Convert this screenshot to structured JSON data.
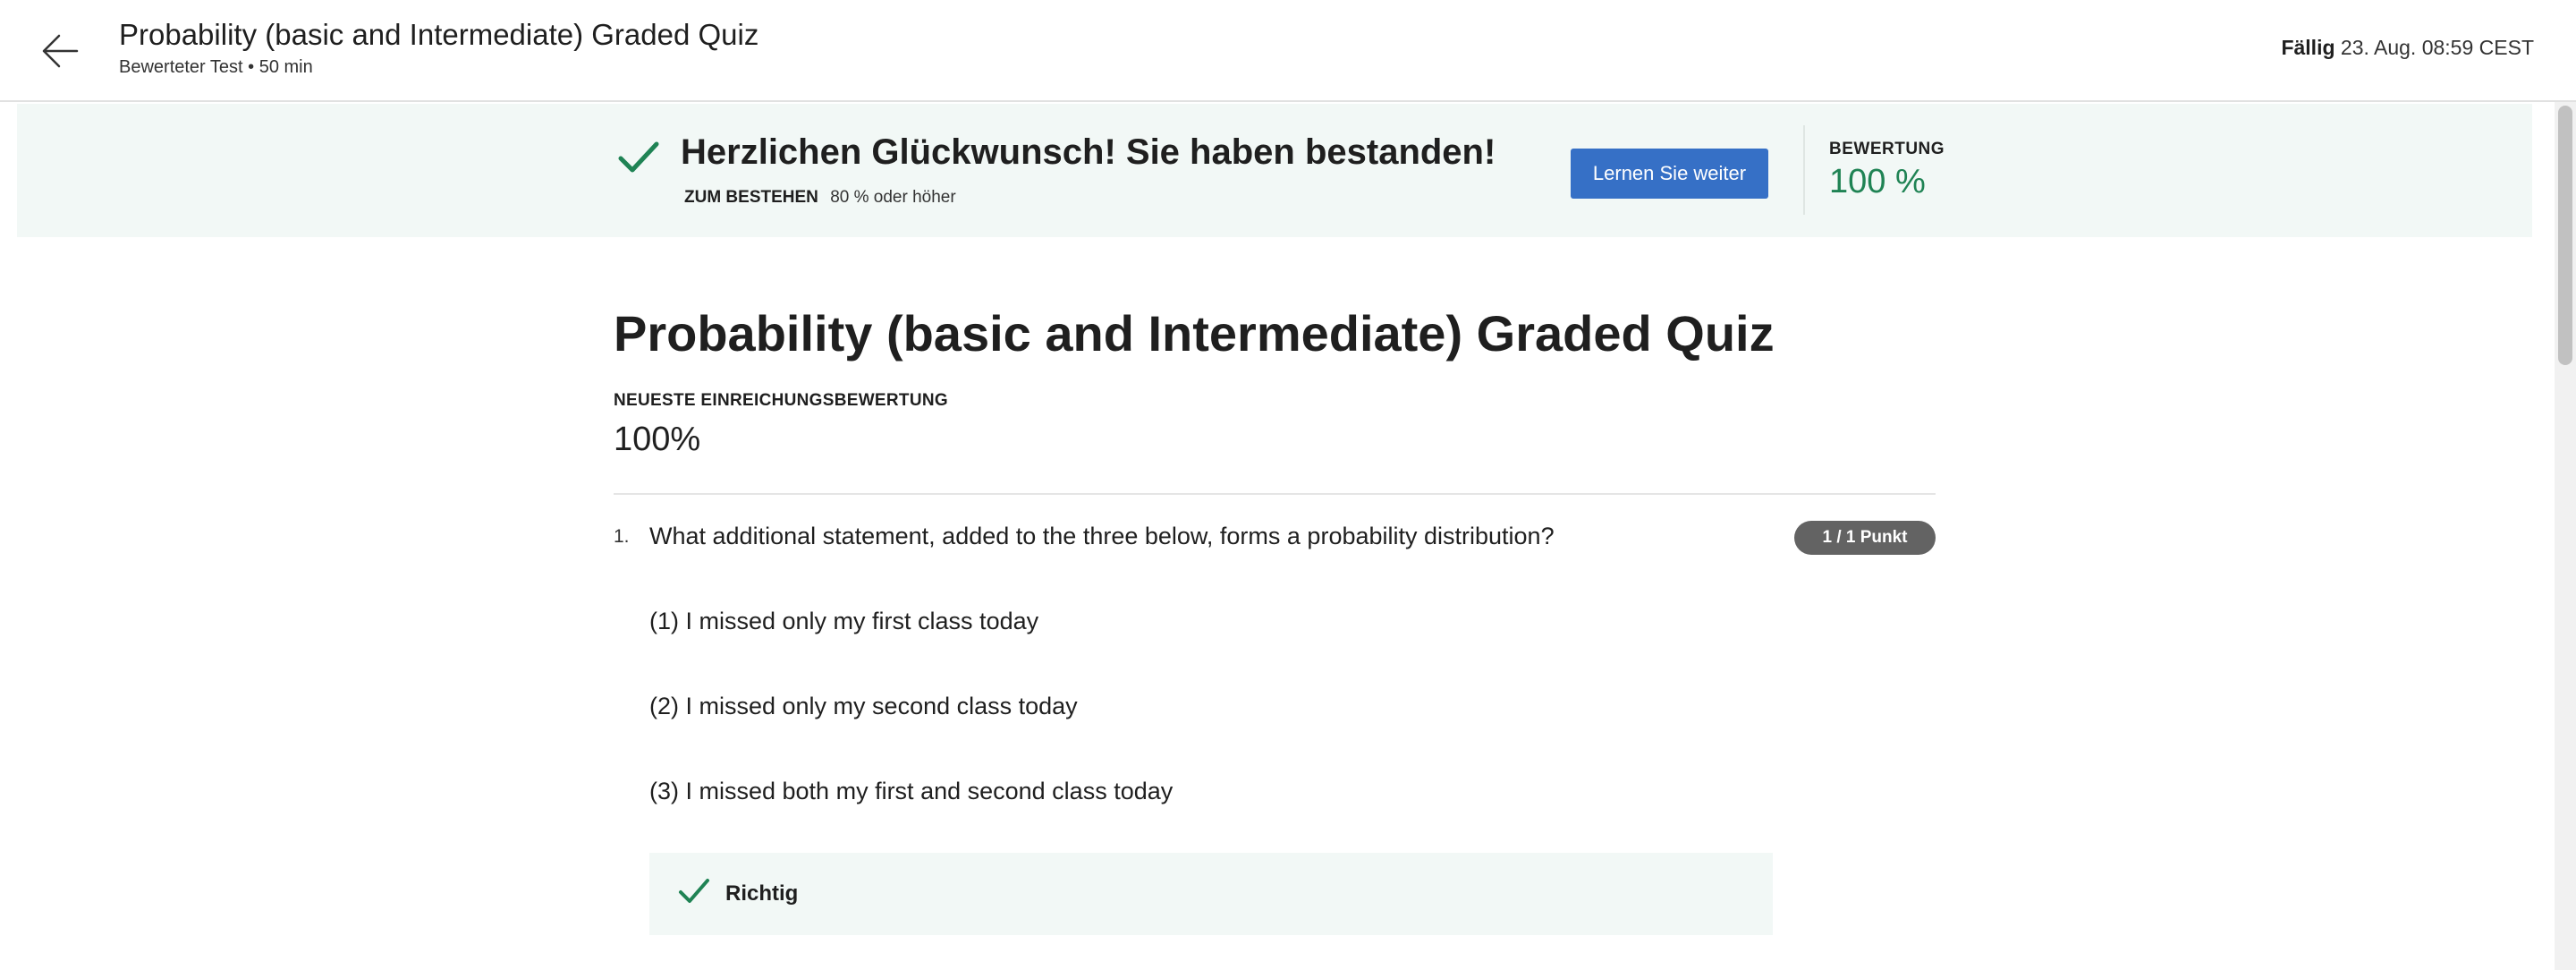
{
  "header": {
    "title": "Probability (basic and Intermediate) Graded Quiz",
    "subtitle": "Bewerteter Test • 50 min",
    "due_label": "Fällig",
    "due_value": "23. Aug. 08:59 CEST"
  },
  "banner": {
    "title": "Herzlichen Glückwunsch! Sie haben bestanden!",
    "pass_label": "ZUM BESTEHEN",
    "pass_value": "80 % oder höher",
    "continue_label": "Lernen Sie weiter",
    "grade_label": "BEWERTUNG",
    "grade_value": "100 %"
  },
  "main": {
    "quiz_title": "Probability (basic and Intermediate) Graded Quiz",
    "latest_label": "NEUESTE EINREICHUNGSBEWERTUNG",
    "latest_value": "100%"
  },
  "question": {
    "number": "1.",
    "text": "What additional statement, added to the three below, forms a probability distribution?",
    "points": "1 / 1 Punkt",
    "statements": [
      "(1) I missed only my first class today",
      "(2) I missed only my second class today",
      "(3) I missed both my first and second class today"
    ],
    "feedback": "Richtig"
  },
  "colors": {
    "accent_blue": "#3670c6",
    "success_green": "#1f8354",
    "banner_bg": "#f2f8f6",
    "badge_gray": "#636363"
  },
  "icons": {
    "back": "arrow-left-icon",
    "banner_check": "check-icon",
    "feedback_check": "check-icon"
  }
}
